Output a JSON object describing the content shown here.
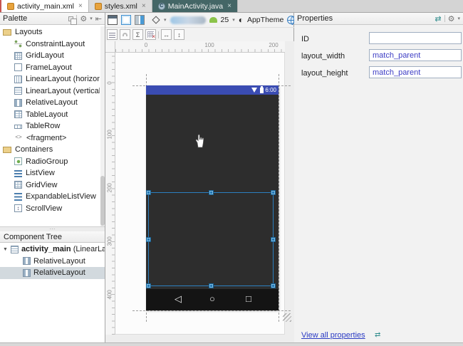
{
  "tabs": [
    {
      "label": "activity_main.xml",
      "state": "active"
    },
    {
      "label": "styles.xml",
      "state": "normal"
    },
    {
      "label": "MainActivity.java",
      "state": "dark"
    }
  ],
  "ui": {
    "close_glyph": "×",
    "caret_down": "▾",
    "tree_twisty": "▼",
    "splitter_dots": "···",
    "gear_glyph": "⚙",
    "collapse_glyph": "⇤",
    "swap_glyph": "⇄"
  },
  "palette": {
    "title": "Palette",
    "sections": [
      {
        "label": "Layouts",
        "items": [
          "ConstraintLayout",
          "GridLayout",
          "FrameLayout",
          "LinearLayout (horizontal)",
          "LinearLayout (vertical)",
          "RelativeLayout",
          "TableLayout",
          "TableRow",
          "<fragment>"
        ]
      },
      {
        "label": "Containers",
        "items": [
          "RadioGroup",
          "ListView",
          "GridView",
          "ExpandableListView",
          "ScrollView"
        ]
      }
    ],
    "fragment_icon_glyph": "<>"
  },
  "component_tree": {
    "title": "Component Tree",
    "root_name": "activity_main",
    "root_suffix": " (LinearLay",
    "children": [
      "RelativeLayout",
      "RelativeLayout"
    ],
    "selected_index": 1
  },
  "design_toolbar": {
    "api_level": "25",
    "theme": "AppTheme",
    "sigma_glyph": "Σ",
    "h_arrow_glyph": "↔",
    "v_arrow_glyph": "↕"
  },
  "canvas": {
    "h_ruler": [
      "0",
      "100",
      "200"
    ],
    "v_ruler": [
      "0",
      "100",
      "200",
      "300",
      "400"
    ],
    "statusbar_time": "6:00",
    "nav": {
      "back": "◁",
      "home": "○",
      "recents": "□"
    }
  },
  "properties": {
    "title": "Properties",
    "fields": [
      {
        "label": "ID",
        "value": ""
      },
      {
        "label": "layout_width",
        "value": "match_parent"
      },
      {
        "label": "layout_height",
        "value": "match_parent"
      }
    ],
    "link": "View all properties"
  },
  "colors": {
    "statusbar_blue": "#3a4cb2",
    "selection_blue": "#2c7fbf",
    "match_parent_text": "#3c3cc4",
    "link_blue": "#2b3bc4",
    "dark_tab": "#446666",
    "accent_blueprint": "#3e8fd0"
  }
}
